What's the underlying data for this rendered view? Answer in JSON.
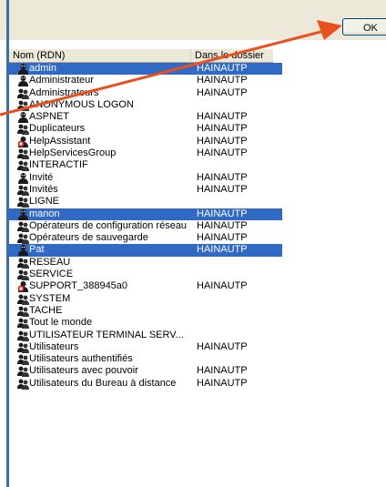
{
  "ok_button": {
    "label": "OK"
  },
  "columns": {
    "name": "Nom (RDN)",
    "dossier": "Dans le dossier"
  },
  "rows": [
    {
      "name": "admin",
      "dossier": "HAINAUTP",
      "selected": true,
      "icon": "user-icon"
    },
    {
      "name": "Administrateur",
      "dossier": "HAINAUTP",
      "selected": false,
      "icon": "user-icon"
    },
    {
      "name": "Administrateurs",
      "dossier": "HAINAUTP",
      "selected": false,
      "icon": "group-icon"
    },
    {
      "name": "ANONYMOUS LOGON",
      "dossier": "",
      "selected": false,
      "icon": "group-icon"
    },
    {
      "name": "ASPNET",
      "dossier": "HAINAUTP",
      "selected": false,
      "icon": "user-icon"
    },
    {
      "name": "Duplicateurs",
      "dossier": "HAINAUTP",
      "selected": false,
      "icon": "group-icon"
    },
    {
      "name": "HelpAssistant",
      "dossier": "HAINAUTP",
      "selected": false,
      "icon": "disabled-user-icon"
    },
    {
      "name": "HelpServicesGroup",
      "dossier": "HAINAUTP",
      "selected": false,
      "icon": "group-icon"
    },
    {
      "name": "INTERACTIF",
      "dossier": "",
      "selected": false,
      "icon": "group-icon"
    },
    {
      "name": "Invité",
      "dossier": "HAINAUTP",
      "selected": false,
      "icon": "user-icon"
    },
    {
      "name": "Invités",
      "dossier": "HAINAUTP",
      "selected": false,
      "icon": "group-icon"
    },
    {
      "name": "LIGNE",
      "dossier": "",
      "selected": false,
      "icon": "group-icon"
    },
    {
      "name": "manon",
      "dossier": "HAINAUTP",
      "selected": true,
      "icon": "user-icon"
    },
    {
      "name": "Opérateurs de configuration réseau",
      "dossier": "HAINAUTP",
      "selected": false,
      "icon": "group-icon"
    },
    {
      "name": "Opérateurs de sauvegarde",
      "dossier": "HAINAUTP",
      "selected": false,
      "icon": "group-icon"
    },
    {
      "name": "Pat",
      "dossier": "HAINAUTP",
      "selected": true,
      "icon": "user-icon"
    },
    {
      "name": "RESEAU",
      "dossier": "",
      "selected": false,
      "icon": "group-icon"
    },
    {
      "name": "SERVICE",
      "dossier": "",
      "selected": false,
      "icon": "group-icon"
    },
    {
      "name": "SUPPORT_388945a0",
      "dossier": "HAINAUTP",
      "selected": false,
      "icon": "disabled-user-icon"
    },
    {
      "name": "SYSTEM",
      "dossier": "",
      "selected": false,
      "icon": "group-icon"
    },
    {
      "name": "TACHE",
      "dossier": "",
      "selected": false,
      "icon": "group-icon"
    },
    {
      "name": "Tout le monde",
      "dossier": "",
      "selected": false,
      "icon": "group-icon"
    },
    {
      "name": "UTILISATEUR TERMINAL SERV...",
      "dossier": "",
      "selected": false,
      "icon": "group-icon"
    },
    {
      "name": "Utilisateurs",
      "dossier": "HAINAUTP",
      "selected": false,
      "icon": "group-icon"
    },
    {
      "name": "Utilisateurs authentifiés",
      "dossier": "",
      "selected": false,
      "icon": "group-icon"
    },
    {
      "name": "Utilisateurs avec pouvoir",
      "dossier": "HAINAUTP",
      "selected": false,
      "icon": "group-icon"
    },
    {
      "name": "Utilisateurs du Bureau à distance",
      "dossier": "HAINAUTP",
      "selected": false,
      "icon": "group-icon"
    }
  ],
  "colors": {
    "selection": "#316ac5",
    "arrow": "#e8501e",
    "dialog_bg": "#ece9d8"
  }
}
